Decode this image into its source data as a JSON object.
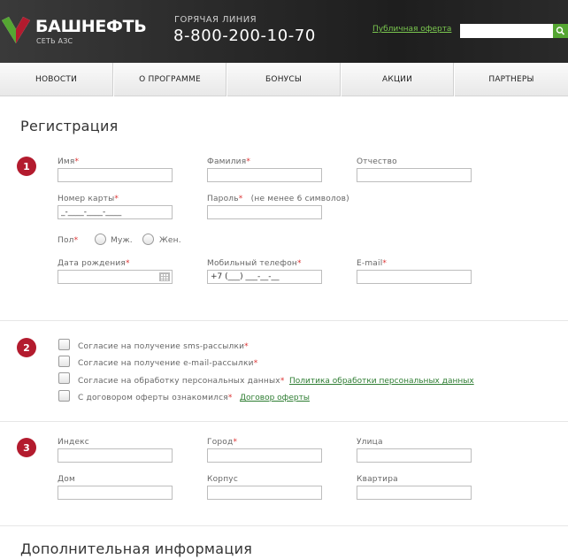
{
  "header": {
    "brand": "БАШНЕФТЬ",
    "brand_sub": "СЕТЬ АЗС",
    "hotline_label": "ГОРЯЧАЯ ЛИНИЯ",
    "hotline_phone": "8-800-200-10-70",
    "offer_link": "Публичная оферта",
    "search_value": "",
    "colors": {
      "brand_red": "#b31b2e",
      "brand_green": "#55a632"
    }
  },
  "nav": [
    "НОВОСТИ",
    "О ПРОГРАММЕ",
    "БОНУСЫ",
    "АКЦИИ",
    "ПАРТНЕРЫ"
  ],
  "page_title": "Регистрация",
  "section1": {
    "num": "1",
    "first_name": "Имя",
    "last_name": "Фамилия",
    "middle_name": "Отчество",
    "card_number": "Номер карты",
    "card_number_value": "_-____-____-____",
    "password": "Пароль",
    "password_hint": "(не менее 6 символов)",
    "gender": "Пол",
    "gender_male": "Муж.",
    "gender_female": "Жен.",
    "birth_date": "Дата рождения",
    "mobile": "Мобильный телефон",
    "mobile_value": "+7 (___) ___-__-__",
    "email": "E-mail",
    "required_mark": "*"
  },
  "section2": {
    "num": "2",
    "sms": "Согласие на получение sms-рассылки",
    "email": "Согласие на получение e-mail-рассылки",
    "personal": "Согласие на обработку персональных данных",
    "personal_link": "Политика обработки персональных данных",
    "offer": "С договором оферты ознакомился",
    "offer_link": "Договор оферты"
  },
  "section3": {
    "num": "3",
    "index": "Индекс",
    "city": "Город",
    "street": "Улица",
    "house": "Дом",
    "building": "Корпус",
    "apartment": "Квартира"
  },
  "extra_title": "Дополнительная информация"
}
